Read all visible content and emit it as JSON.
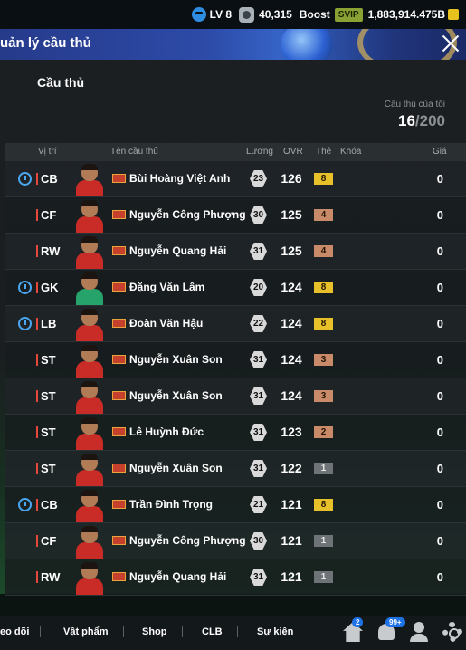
{
  "topbar": {
    "level": "LV 8",
    "coins": "40,315",
    "boost_label": "Boost",
    "svip_label": "SVIP",
    "bp": "1,883,914.475B"
  },
  "header": {
    "title": "uản lý cầu thủ",
    "icons": [
      "close-icon"
    ]
  },
  "main": {
    "section_title": "Cầu thủ",
    "count_label": "Cầu thủ của tôi",
    "count_current": "16",
    "count_max": "/200",
    "columns": [
      "Vị trí",
      "Tên cầu thủ",
      "Lương",
      "OVR",
      "Thẻ",
      "Khóa",
      "Giá"
    ],
    "players": [
      {
        "timer": true,
        "position": "CB",
        "name": "Bùi Hoàng Việt Anh",
        "wage": "23",
        "ovr": "126",
        "card": "8",
        "card_color": "#e8c12a",
        "price": "0",
        "keeper": false
      },
      {
        "timer": false,
        "position": "CF",
        "name": "Nguyễn Công Phượng",
        "wage": "30",
        "ovr": "125",
        "card": "4",
        "card_color": "#c98a6a",
        "price": "0",
        "keeper": false
      },
      {
        "timer": false,
        "position": "RW",
        "name": "Nguyễn Quang Hải",
        "wage": "31",
        "ovr": "125",
        "card": "4",
        "card_color": "#c98a6a",
        "price": "0",
        "keeper": false
      },
      {
        "timer": true,
        "position": "GK",
        "name": "Đặng Văn Lâm",
        "wage": "20",
        "ovr": "124",
        "card": "8",
        "card_color": "#e8c12a",
        "price": "0",
        "keeper": true
      },
      {
        "timer": true,
        "position": "LB",
        "name": "Đoàn Văn Hậu",
        "wage": "22",
        "ovr": "124",
        "card": "8",
        "card_color": "#e8c12a",
        "price": "0",
        "keeper": false
      },
      {
        "timer": false,
        "position": "ST",
        "name": "Nguyễn Xuân Son",
        "wage": "31",
        "ovr": "124",
        "card": "3",
        "card_color": "#c98a6a",
        "price": "0",
        "keeper": false
      },
      {
        "timer": false,
        "position": "ST",
        "name": "Nguyễn Xuân Son",
        "wage": "31",
        "ovr": "124",
        "card": "3",
        "card_color": "#c98a6a",
        "price": "0",
        "keeper": false
      },
      {
        "timer": false,
        "position": "ST",
        "name": "Lê Huỳnh Đức",
        "wage": "31",
        "ovr": "123",
        "card": "2",
        "card_color": "#c98a6a",
        "price": "0",
        "keeper": false
      },
      {
        "timer": false,
        "position": "ST",
        "name": "Nguyễn Xuân Son",
        "wage": "31",
        "ovr": "122",
        "card": "1",
        "card_color": "#6e7378",
        "price": "0",
        "keeper": false
      },
      {
        "timer": true,
        "position": "CB",
        "name": "Trần Đình Trọng",
        "wage": "21",
        "ovr": "121",
        "card": "8",
        "card_color": "#e8c12a",
        "price": "0",
        "keeper": false
      },
      {
        "timer": false,
        "position": "CF",
        "name": "Nguyễn Công Phượng",
        "wage": "30",
        "ovr": "121",
        "card": "1",
        "card_color": "#6e7378",
        "price": "0",
        "keeper": false
      },
      {
        "timer": false,
        "position": "RW",
        "name": "Nguyễn Quang Hải",
        "wage": "31",
        "ovr": "121",
        "card": "1",
        "card_color": "#6e7378",
        "price": "0",
        "keeper": false
      }
    ]
  },
  "bottombar": {
    "items": [
      "eo dõi",
      "Vật phẩm",
      "Shop",
      "CLB",
      "Sự kiện"
    ],
    "home_badge": "2",
    "notif_badge": "99+"
  }
}
